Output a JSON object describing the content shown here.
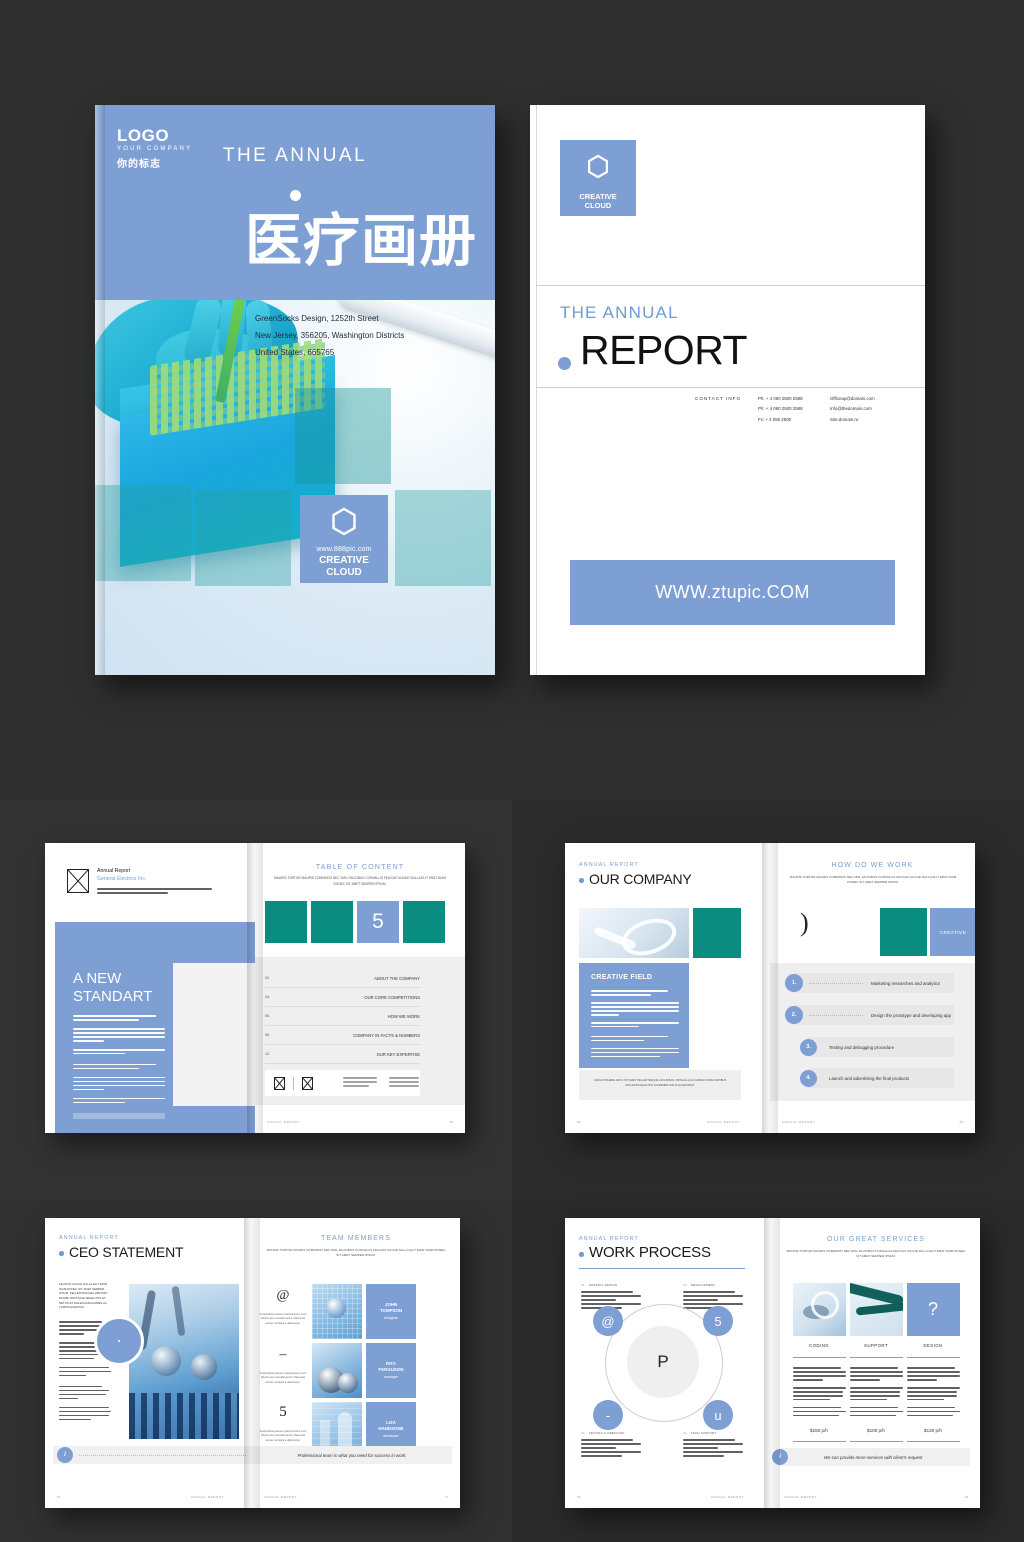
{
  "brand": {
    "accent_blue": "#7e9fd4",
    "accent_teal": "#0a8d80",
    "background": "#2d2d2d"
  },
  "cover": {
    "logo": {
      "main": "LOGO",
      "sub": "YOUR COMPANY",
      "cn": "你的标志"
    },
    "the_annual": "THE ANNUAL",
    "cn_title": "医疗画册",
    "address": [
      "GreenSocks Design, 1252th Street",
      "New Jersey, 356205, Washington Districts",
      "United States, 665765"
    ],
    "badge": {
      "url": "www.888pic.com",
      "line1": "CREATIVE",
      "line2": "CLOUD"
    }
  },
  "backcover": {
    "badge": {
      "line1": "CREATIVE",
      "line2": "CLOUD"
    },
    "the_annual": "THE ANNUAL",
    "report": "REPORT",
    "contact_label": "CONTACT INFO",
    "phones": [
      "Ph: + 4 060 2500 2588",
      "Ph: + 4 060 2500 2588",
      "Fx: + 4 055 2500"
    ],
    "emails": [
      "Officeap@domain.com",
      "Info@thedomain.com",
      "Site:domain.ru"
    ],
    "website_banner": "WWW.ztupic.COM"
  },
  "spread_toc": {
    "left": {
      "kicker": "Annual Report",
      "company": "General Electrics Inc.",
      "intro": "Lorem ipsum dolore sitiena amete, consectetur adipiscing elit. Pellentesque venenatis consequat dolore.",
      "title_line1": "A NEW",
      "title_line2": "STANDART"
    },
    "right": {
      "heading": "TABLE OF CONTENT",
      "lorem": "MAURIS TORTOR MAURIS COMMODO NEC NISL FAUCIBUS CONVALLIS FEUGIAT AUGUE NULLA ELIT ERAT DIAM DONEC SIT AMET SEMPER IPSUM.",
      "tiles": [
        {
          "label": "",
          "color": "#0a8d80"
        },
        {
          "label": "",
          "color": "#0a8d80"
        },
        {
          "label": "5",
          "color": "#7e9fd4"
        },
        {
          "label": "",
          "color": "#0a8d80"
        }
      ],
      "items": [
        {
          "num": "02.",
          "title": "ABOUT THE COMPANY"
        },
        {
          "num": "04.",
          "title": "OUR CORE COMPETITIONS"
        },
        {
          "num": "06.",
          "title": "HOW WE WORK"
        },
        {
          "num": "08.",
          "title": "COMPANY IN FACTS & NUMBERS"
        },
        {
          "num": "12.",
          "title": "OUR KEY EXPERTISE"
        }
      ],
      "footer_label": "ANNUAL REPORT",
      "footer_num": "01"
    }
  },
  "spread_company": {
    "left": {
      "eyebrow": "ANNUAL REPORT",
      "title": "OUR COMPANY",
      "panel_title": "CREATIVE FIELD",
      "caption": "CRAS POSUERE ARCU SIT AMET PELLENTESQUE ACCUMSAN, FRINGILLA ACCUMSAN URNA DAPIBUS PELLENTESQUE NISI CONDIMENTUM ALIQUAM ERAT",
      "footer_label": "ANNUAL REPORT",
      "footer_num": "02"
    },
    "right": {
      "heading": "HOW DO WE WORK",
      "lorem": "MAURIS TORTOR MAURIS COMMODO NEC NISL FAUCIBUS CONVALLIS FEUGIAT AUGUE NULLA ELIT ERAT DIAM DONEC SIT AMET SEMPER IPSUM.",
      "tile_label": "CREATIVE",
      "paren": ")",
      "steps": [
        {
          "num": "1.",
          "text": "Marketing researches and analytics"
        },
        {
          "num": "2.",
          "text": "Design the prototype and developing app"
        },
        {
          "num": "3.",
          "text": "Testing and debugging procedure"
        },
        {
          "num": "4.",
          "text": "Launch and advertising the final products"
        }
      ],
      "footer_label": "ANNUAL REPORT",
      "footer_num": "03"
    }
  },
  "spread_ceo": {
    "left": {
      "eyebrow": "ANNUAL REPORT",
      "title": "CEO STATEMENT",
      "intro": "FEUGIAT AUGUE NULLA ELIT ERAT DIAM DONEC SIT AMET SEMPER IPSUM, PELLENTESQUE HABITANT MORBI TRISTIQUE SENECTUS ET NETUS ET MALESUADA FAMES AC TURPIS EGESTAS.",
      "footer_label": "ANNUAL REPORT",
      "footer_num": "16"
    },
    "right": {
      "heading": "TEAM MEMBERS",
      "lorem": "MAURIS TORTOR MAURIS COMMODO NEC NISL FAUCIBUS CONVALLIS FEUGIAT AUGUE NULLA ELIT ERAT DIAM DONEC SIT AMET SEMPER IPSUM.",
      "glyphs": [
        "@",
        "–",
        "5"
      ],
      "glyph_caption": "Suspendisse posuere placerat lorem nunc lobortis arcu convallis auctor. Maecenas semper vel ligula a ullamcorper.",
      "members": [
        {
          "name_line1": "JOHN",
          "name_line2": "TOMPSON",
          "role": "designer"
        },
        {
          "name_line1": "RITA",
          "name_line2": "FERGUSON",
          "role": "manager"
        },
        {
          "name_line1": "LIZA",
          "name_line2": "HANDSONE",
          "role": "developer"
        }
      ],
      "note_badge": "i",
      "note": "Professional team is what you need for success in work.",
      "footer_label": "ANNUAL REPORT",
      "footer_num": "17"
    }
  },
  "spread_process": {
    "left": {
      "eyebrow": "ANNUAL REPORT",
      "title": "WORK PROCESS",
      "core": "P",
      "quadrants": [
        {
          "num": "01.",
          "label": "GRAPHIC DESIGN"
        },
        {
          "num": "02.",
          "label": "DEVELOPMENT"
        },
        {
          "num": "03.",
          "label": "TESTING & DEBUGING"
        },
        {
          "num": "04.",
          "label": "TECH SUPPORT"
        }
      ],
      "nodes": [
        "@",
        "5",
        "-",
        "u"
      ],
      "footer_label": "ANNUAL REPORT",
      "footer_num": "18"
    },
    "right": {
      "heading": "OUR GREAT SERVICES",
      "lorem": "MAURIS TORTOR MAURIS COMMODO NEC NISL FAUCIBUS CONVALLIS FEUGIAT AUGUE NULLA ELIT ERAT DIAM DONEC SIT AMET SEMPER IPSUM.",
      "question_tile": "?",
      "services": [
        {
          "name": "CODING",
          "price": "$150 p/h"
        },
        {
          "name": "SUPPORT",
          "price": "$100 p/h"
        },
        {
          "name": "DESIGN",
          "price": "$130 p/h"
        }
      ],
      "note_badge": "i",
      "note": "We can provide more services with client's request",
      "footer_label": "ANNUAL REPORT",
      "footer_num": "19"
    }
  }
}
